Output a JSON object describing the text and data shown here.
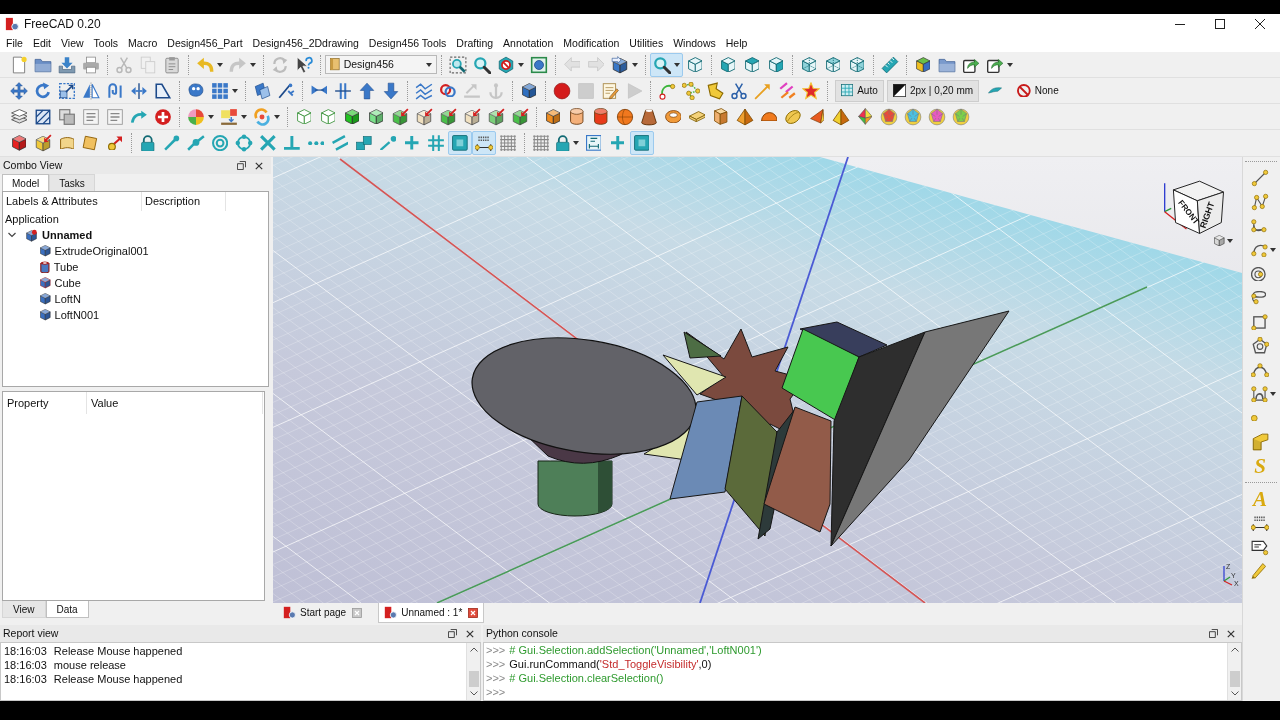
{
  "title_bar": {
    "title": "FreeCAD 0.20"
  },
  "menu_bar": [
    "File",
    "Edit",
    "View",
    "Tools",
    "Macro",
    "Design456_Part",
    "Design456_2Ddrawing",
    "Design456 Tools",
    "Drafting",
    "Annotation",
    "Modification",
    "Utilities",
    "Windows",
    "Help"
  ],
  "toolbars": [
    [
      {
        "kind": "icons",
        "buttons": [
          {
            "pressed": false,
            "disabled": false
          },
          {
            "pressed": false,
            "disabled": false
          },
          {
            "pressed": false,
            "disabled": false
          },
          {
            "pressed": false,
            "disabled": false
          }
        ]
      },
      {
        "kind": "icons",
        "buttons": [
          {
            "pressed": false,
            "disabled": true
          },
          {
            "pressed": false,
            "disabled": true
          },
          {
            "pressed": false,
            "disabled": false
          }
        ]
      },
      {
        "kind": "icons",
        "buttons": [
          {
            "pressed": false,
            "disabled": false,
            "menu": true
          },
          {
            "pressed": false,
            "disabled": true,
            "menu": true
          }
        ]
      },
      {
        "kind": "icons",
        "buttons": [
          {
            "pressed": false,
            "disabled": true
          },
          {
            "pressed": false,
            "disabled": false
          }
        ]
      },
      {
        "kind": "combo",
        "value": "Design456"
      },
      {
        "kind": "icons",
        "buttons": [
          {
            "pressed": false,
            "disabled": false
          },
          {
            "pressed": false,
            "disabled": false
          },
          {
            "pressed": false,
            "disabled": false,
            "menu": true
          },
          {
            "pressed": false,
            "disabled": false
          }
        ]
      },
      {
        "kind": "icons",
        "buttons": [
          {
            "pressed": false,
            "disabled": true
          },
          {
            "pressed": false,
            "disabled": true
          },
          {
            "pressed": false,
            "disabled": false,
            "menu": true
          }
        ]
      },
      {
        "kind": "icons",
        "buttons": [
          {
            "pressed": true,
            "disabled": false,
            "menu": true
          },
          {
            "pressed": false,
            "disabled": false
          }
        ]
      },
      {
        "kind": "icons",
        "buttons": [
          {
            "pressed": false,
            "disabled": false
          },
          {
            "pressed": false,
            "disabled": false
          },
          {
            "pressed": false,
            "disabled": false
          }
        ]
      },
      {
        "kind": "icons",
        "buttons": [
          {
            "pressed": false,
            "disabled": false
          },
          {
            "pressed": false,
            "disabled": false
          },
          {
            "pressed": false,
            "disabled": false
          }
        ]
      },
      {
        "kind": "icons",
        "buttons": [
          {
            "pressed": false,
            "disabled": false
          }
        ]
      },
      {
        "kind": "icons",
        "buttons": [
          {
            "pressed": false,
            "disabled": false
          },
          {
            "pressed": false,
            "disabled": false
          },
          {
            "pressed": false,
            "disabled": false
          },
          {
            "pressed": false,
            "disabled": false,
            "menu": true
          }
        ]
      }
    ],
    [
      {
        "kind": "icons",
        "buttons": [
          {
            "pressed": false,
            "disabled": false
          },
          {
            "pressed": false,
            "disabled": false
          },
          {
            "pressed": false,
            "disabled": false
          },
          {
            "pressed": false,
            "disabled": false
          },
          {
            "pressed": false,
            "disabled": false
          },
          {
            "pressed": false,
            "disabled": false
          },
          {
            "pressed": false,
            "disabled": false
          }
        ]
      },
      {
        "kind": "icons",
        "buttons": [
          {
            "pressed": false,
            "disabled": false
          },
          {
            "pressed": false,
            "disabled": false,
            "menu": true
          }
        ]
      },
      {
        "kind": "icons",
        "buttons": [
          {
            "pressed": false,
            "disabled": false
          },
          {
            "pressed": false,
            "disabled": false
          }
        ]
      },
      {
        "kind": "icons",
        "buttons": [
          {
            "pressed": false,
            "disabled": false
          },
          {
            "pressed": false,
            "disabled": false
          },
          {
            "pressed": false,
            "disabled": false
          },
          {
            "pressed": false,
            "disabled": false
          }
        ]
      },
      {
        "kind": "icons",
        "buttons": [
          {
            "pressed": false,
            "disabled": false
          },
          {
            "pressed": false,
            "disabled": false
          },
          {
            "pressed": false,
            "disabled": true
          },
          {
            "pressed": false,
            "disabled": true
          }
        ]
      },
      {
        "kind": "icons",
        "buttons": [
          {
            "pressed": false,
            "disabled": false
          }
        ]
      },
      {
        "kind": "icons",
        "buttons": [
          {
            "pressed": false,
            "disabled": false
          },
          {
            "pressed": false,
            "disabled": true
          },
          {
            "pressed": false,
            "disabled": false
          },
          {
            "pressed": false,
            "disabled": true
          }
        ]
      },
      {
        "kind": "icons",
        "buttons": [
          {
            "pressed": false,
            "disabled": false
          },
          {
            "pressed": false,
            "disabled": false
          },
          {
            "pressed": false,
            "disabled": false
          },
          {
            "pressed": false,
            "disabled": false
          },
          {
            "pressed": false,
            "disabled": false
          },
          {
            "pressed": false,
            "disabled": false
          },
          {
            "pressed": false,
            "disabled": false
          }
        ]
      },
      {
        "kind": "labeled",
        "buttons": [
          {
            "label": "Auto",
            "pressed": false
          },
          {
            "label": "2px | 0,20 mm",
            "pressed": false
          },
          {
            "pressed": false
          },
          {
            "label": "None",
            "pressed": false
          }
        ]
      }
    ],
    [
      {
        "kind": "icons",
        "buttons": [
          {
            "pressed": false,
            "disabled": false
          },
          {
            "pressed": false,
            "disabled": false
          },
          {
            "pressed": false,
            "disabled": false
          },
          {
            "pressed": false,
            "disabled": false
          },
          {
            "pressed": false,
            "disabled": false
          },
          {
            "pressed": false,
            "disabled": false
          },
          {
            "pressed": false,
            "disabled": false
          }
        ]
      },
      {
        "kind": "icons",
        "buttons": [
          {
            "pressed": false,
            "disabled": false,
            "menu": true
          },
          {
            "pressed": false,
            "disabled": false,
            "menu": true
          },
          {
            "pressed": false,
            "disabled": false,
            "menu": true
          }
        ]
      },
      {
        "kind": "icons",
        "buttons": [
          {
            "pressed": false,
            "disabled": false
          },
          {
            "pressed": false,
            "disabled": false
          },
          {
            "pressed": false,
            "disabled": false
          },
          {
            "pressed": false,
            "disabled": false
          },
          {
            "pressed": false,
            "disabled": false
          },
          {
            "pressed": false,
            "disabled": false
          },
          {
            "pressed": false,
            "disabled": false
          },
          {
            "pressed": false,
            "disabled": false
          },
          {
            "pressed": false,
            "disabled": false
          },
          {
            "pressed": false,
            "disabled": false
          }
        ]
      },
      {
        "kind": "icons",
        "buttons": [
          {
            "pressed": false,
            "disabled": false
          },
          {
            "pressed": false,
            "disabled": false
          },
          {
            "pressed": false,
            "disabled": false
          },
          {
            "pressed": false,
            "disabled": false
          },
          {
            "pressed": false,
            "disabled": false
          },
          {
            "pressed": false,
            "disabled": false
          },
          {
            "pressed": false,
            "disabled": false
          },
          {
            "pressed": false,
            "disabled": false
          },
          {
            "pressed": false,
            "disabled": false
          },
          {
            "pressed": false,
            "disabled": false
          },
          {
            "pressed": false,
            "disabled": false
          },
          {
            "pressed": false,
            "disabled": false
          },
          {
            "pressed": false,
            "disabled": false
          },
          {
            "pressed": false,
            "disabled": false
          },
          {
            "pressed": false,
            "disabled": false
          },
          {
            "pressed": false,
            "disabled": false
          },
          {
            "pressed": false,
            "disabled": false
          },
          {
            "pressed": false,
            "disabled": false
          }
        ]
      }
    ],
    [
      {
        "kind": "icons",
        "buttons": [
          {
            "pressed": false,
            "disabled": false
          },
          {
            "pressed": false,
            "disabled": false
          },
          {
            "pressed": false,
            "disabled": false
          },
          {
            "pressed": false,
            "disabled": false
          },
          {
            "pressed": false,
            "disabled": false
          }
        ]
      },
      {
        "kind": "icons",
        "buttons": [
          {
            "pressed": false,
            "disabled": false
          },
          {
            "pressed": false,
            "disabled": false
          },
          {
            "pressed": false,
            "disabled": false
          },
          {
            "pressed": false,
            "disabled": false
          },
          {
            "pressed": false,
            "disabled": false
          },
          {
            "pressed": false,
            "disabled": false
          },
          {
            "pressed": false,
            "disabled": false
          },
          {
            "pressed": false,
            "disabled": false
          },
          {
            "pressed": false,
            "disabled": false
          },
          {
            "pressed": false,
            "disabled": false
          },
          {
            "pressed": false,
            "disabled": false
          },
          {
            "pressed": false,
            "disabled": false
          },
          {
            "pressed": false,
            "disabled": false
          },
          {
            "pressed": true,
            "disabled": false
          },
          {
            "pressed": true,
            "disabled": false
          },
          {
            "pressed": false,
            "disabled": false
          }
        ]
      },
      {
        "kind": "icons",
        "buttons": [
          {
            "pressed": false,
            "disabled": false
          },
          {
            "pressed": false,
            "disabled": false,
            "menu": true
          },
          {
            "pressed": false,
            "disabled": false
          },
          {
            "pressed": false,
            "disabled": false
          },
          {
            "pressed": true,
            "disabled": false
          }
        ]
      }
    ]
  ],
  "combo_view": {
    "title": "Combo View",
    "tabs": [
      {
        "label": "Model",
        "selected": true
      },
      {
        "label": "Tasks",
        "selected": false
      }
    ],
    "tree": {
      "columns": [
        "Labels & Attributes",
        "Description"
      ],
      "root_label": "Application",
      "items": [
        {
          "label": "Unnamed",
          "kind": "document",
          "expanded": true,
          "children": [
            {
              "label": "ExtrudeOriginal001",
              "kind": "solid"
            },
            {
              "label": "Tube",
              "kind": "tube"
            },
            {
              "label": "Cube",
              "kind": "cube"
            },
            {
              "label": "LoftN",
              "kind": "solid"
            },
            {
              "label": "LoftN001",
              "kind": "solid"
            }
          ]
        }
      ]
    },
    "properties": {
      "columns": [
        "Property",
        "Value"
      ]
    },
    "bottom_tabs": [
      {
        "label": "View",
        "selected": false
      },
      {
        "label": "Data",
        "selected": true
      }
    ]
  },
  "viewport": {
    "nav_cube": {
      "faces": [
        "FRONT",
        "RIGHT"
      ]
    },
    "axis_labels": [
      "Z",
      "Y",
      "X"
    ]
  },
  "document_tabs": [
    {
      "label": "Start page",
      "selected": false
    },
    {
      "label": "Unnamed : 1*",
      "selected": true
    }
  ],
  "right_toolbar": [
    {
      "buttons": [
        {
          "kind": "icon"
        },
        {
          "kind": "icon"
        },
        {
          "kind": "icon"
        },
        {
          "kind": "icon",
          "menu": true
        },
        {
          "kind": "icon"
        },
        {
          "kind": "icon"
        },
        {
          "kind": "icon"
        },
        {
          "kind": "icon"
        },
        {
          "kind": "icon"
        },
        {
          "kind": "icon",
          "menu": true
        },
        {
          "kind": "icon"
        },
        {
          "kind": "icon"
        },
        {
          "kind": "glyph",
          "text": "S"
        }
      ]
    },
    {
      "buttons": [
        {
          "kind": "glyph",
          "text": "A"
        },
        {
          "kind": "icon"
        },
        {
          "kind": "icon"
        },
        {
          "kind": "icon"
        }
      ]
    }
  ],
  "report_view": {
    "title": "Report view",
    "lines": [
      {
        "time": "18:16:03",
        "message": "Release Mouse happened"
      },
      {
        "time": "18:16:03",
        "message": "mouse release"
      },
      {
        "time": "18:16:03",
        "message": "Release Mouse happened"
      }
    ]
  },
  "python_console": {
    "title": "Python console",
    "lines": [
      {
        "prompt": ">>>",
        "segments": [
          {
            "kind": "comment",
            "text": "# Gui.Selection.addSelection('Unnamed','LoftN001')"
          }
        ]
      },
      {
        "prompt": ">>>",
        "segments": [
          {
            "kind": "code",
            "text": "Gui.runCommand("
          },
          {
            "kind": "string",
            "text": "'Std_ToggleVisibility'"
          },
          {
            "kind": "code",
            "text": ",0)"
          }
        ]
      },
      {
        "prompt": ">>>",
        "segments": [
          {
            "kind": "comment",
            "text": "# Gui.Selection.clearSelection()"
          }
        ]
      },
      {
        "prompt": ">>>"
      }
    ]
  }
}
